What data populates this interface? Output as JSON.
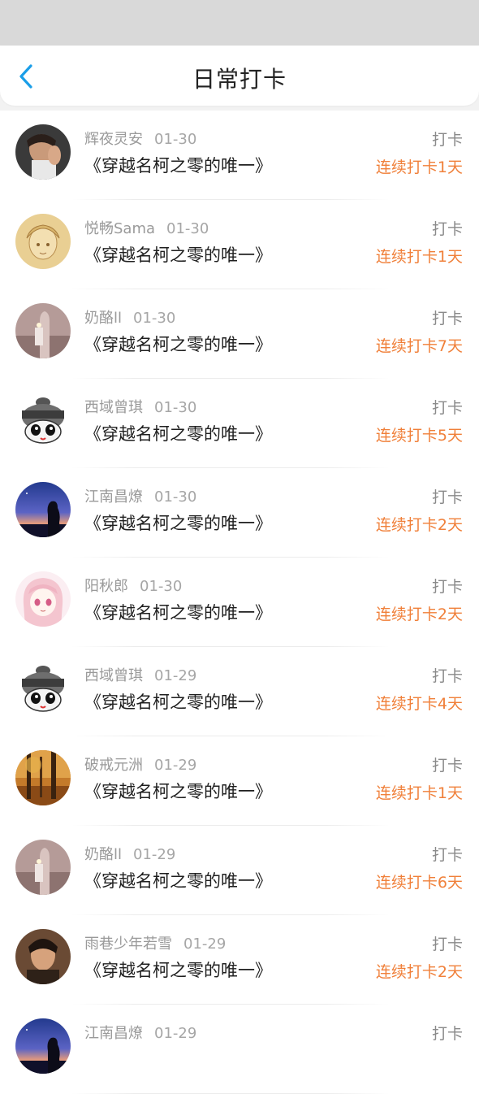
{
  "header": {
    "title": "日常打卡",
    "back_icon": "chevron-left-icon",
    "accent_color": "#1a9ee8"
  },
  "colors": {
    "streak": "#f0803a",
    "name": "#9a9a9a"
  },
  "entries": [
    {
      "name": "辉夜灵安",
      "date": "01-30",
      "book": "《穿越名柯之零的唯一》",
      "action": "打卡",
      "streak": "连续打卡1天",
      "avatar": "photo-man"
    },
    {
      "name": "悦畅Sama",
      "date": "01-30",
      "book": "《穿越名柯之零的唯一》",
      "action": "打卡",
      "streak": "连续打卡1天",
      "avatar": "sketch-girl"
    },
    {
      "name": "奶酪ll",
      "date": "01-30",
      "book": "《穿越名柯之零的唯一》",
      "action": "打卡",
      "streak": "连续打卡7天",
      "avatar": "hand-candle"
    },
    {
      "name": "西域曾琪",
      "date": "01-30",
      "book": "《穿越名柯之零的唯一》",
      "action": "打卡",
      "streak": "连续打卡5天",
      "avatar": "cartoon-mascot"
    },
    {
      "name": "江南昌燎",
      "date": "01-30",
      "book": "《穿越名柯之零的唯一》",
      "action": "打卡",
      "streak": "连续打卡2天",
      "avatar": "night-silhouette"
    },
    {
      "name": "阳秋郎",
      "date": "01-30",
      "book": "《穿越名柯之零的唯一》",
      "action": "打卡",
      "streak": "连续打卡2天",
      "avatar": "anime-girl"
    },
    {
      "name": "西域曾琪",
      "date": "01-29",
      "book": "《穿越名柯之零的唯一》",
      "action": "打卡",
      "streak": "连续打卡4天",
      "avatar": "cartoon-mascot"
    },
    {
      "name": "破戒元洲",
      "date": "01-29",
      "book": "《穿越名柯之零的唯一》",
      "action": "打卡",
      "streak": "连续打卡1天",
      "avatar": "autumn-forest"
    },
    {
      "name": "奶酪ll",
      "date": "01-29",
      "book": "《穿越名柯之零的唯一》",
      "action": "打卡",
      "streak": "连续打卡6天",
      "avatar": "hand-candle"
    },
    {
      "name": "雨巷少年若雪",
      "date": "01-29",
      "book": "《穿越名柯之零的唯一》",
      "action": "打卡",
      "streak": "连续打卡2天",
      "avatar": "photo-man-dark"
    },
    {
      "name": "江南昌燎",
      "date": "01-29",
      "book": "",
      "action": "打卡",
      "streak": "",
      "avatar": "night-silhouette"
    }
  ]
}
